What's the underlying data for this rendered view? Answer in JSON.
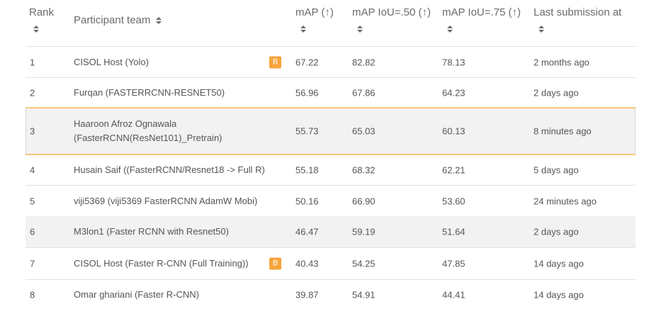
{
  "headers": {
    "rank": "Rank",
    "team": "Participant team",
    "map": "mAP (↑)",
    "map50": "mAP IoU=.50 (↑)",
    "map75": "mAP IoU=.75 (↑)",
    "last": "Last submission at"
  },
  "rows": [
    {
      "rank": "1",
      "team": "CISOL Host (Yolo)",
      "badge": "B",
      "map": "67.22",
      "map50": "82.82",
      "map75": "78.13",
      "last": "2 months ago"
    },
    {
      "rank": "2",
      "team": "Furqan (FASTERRCNN-RESNET50)",
      "badge": "",
      "map": "56.96",
      "map50": "67.86",
      "map75": "64.23",
      "last": "2 days ago"
    },
    {
      "rank": "3",
      "team": "Haaroon Afroz Ognawala (FasterRCNN(ResNet101)_Pretrain)",
      "team_line1": "Haaroon Afroz Ognawala",
      "team_line2": "(FasterRCNN(ResNet101)_Pretrain)",
      "badge": "",
      "map": "55.73",
      "map50": "65.03",
      "map75": "60.13",
      "last": "8 minutes ago"
    },
    {
      "rank": "4",
      "team": "Husain Saif ((FasterRCNN/Resnet18 -> Full R)",
      "badge": "",
      "map": "55.18",
      "map50": "68.32",
      "map75": "62.21",
      "last": "5 days ago"
    },
    {
      "rank": "5",
      "team": "viji5369 (viji5369 FasterRCNN AdamW Mobi)",
      "badge": "",
      "map": "50.16",
      "map50": "66.90",
      "map75": "53.60",
      "last": "24 minutes ago"
    },
    {
      "rank": "6",
      "team": "M3lon1 (Faster RCNN with Resnet50)",
      "badge": "",
      "map": "46.47",
      "map50": "59.19",
      "map75": "51.64",
      "last": "2 days ago"
    },
    {
      "rank": "7",
      "team": "CISOL Host (Faster R-CNN (Full Training))",
      "badge": "B",
      "map": "40.43",
      "map50": "54.25",
      "map75": "47.85",
      "last": "14 days ago"
    },
    {
      "rank": "8",
      "team": "Omar ghariani (Faster R-CNN)",
      "badge": "",
      "map": "39.87",
      "map50": "54.91",
      "map75": "44.41",
      "last": "14 days ago"
    }
  ]
}
